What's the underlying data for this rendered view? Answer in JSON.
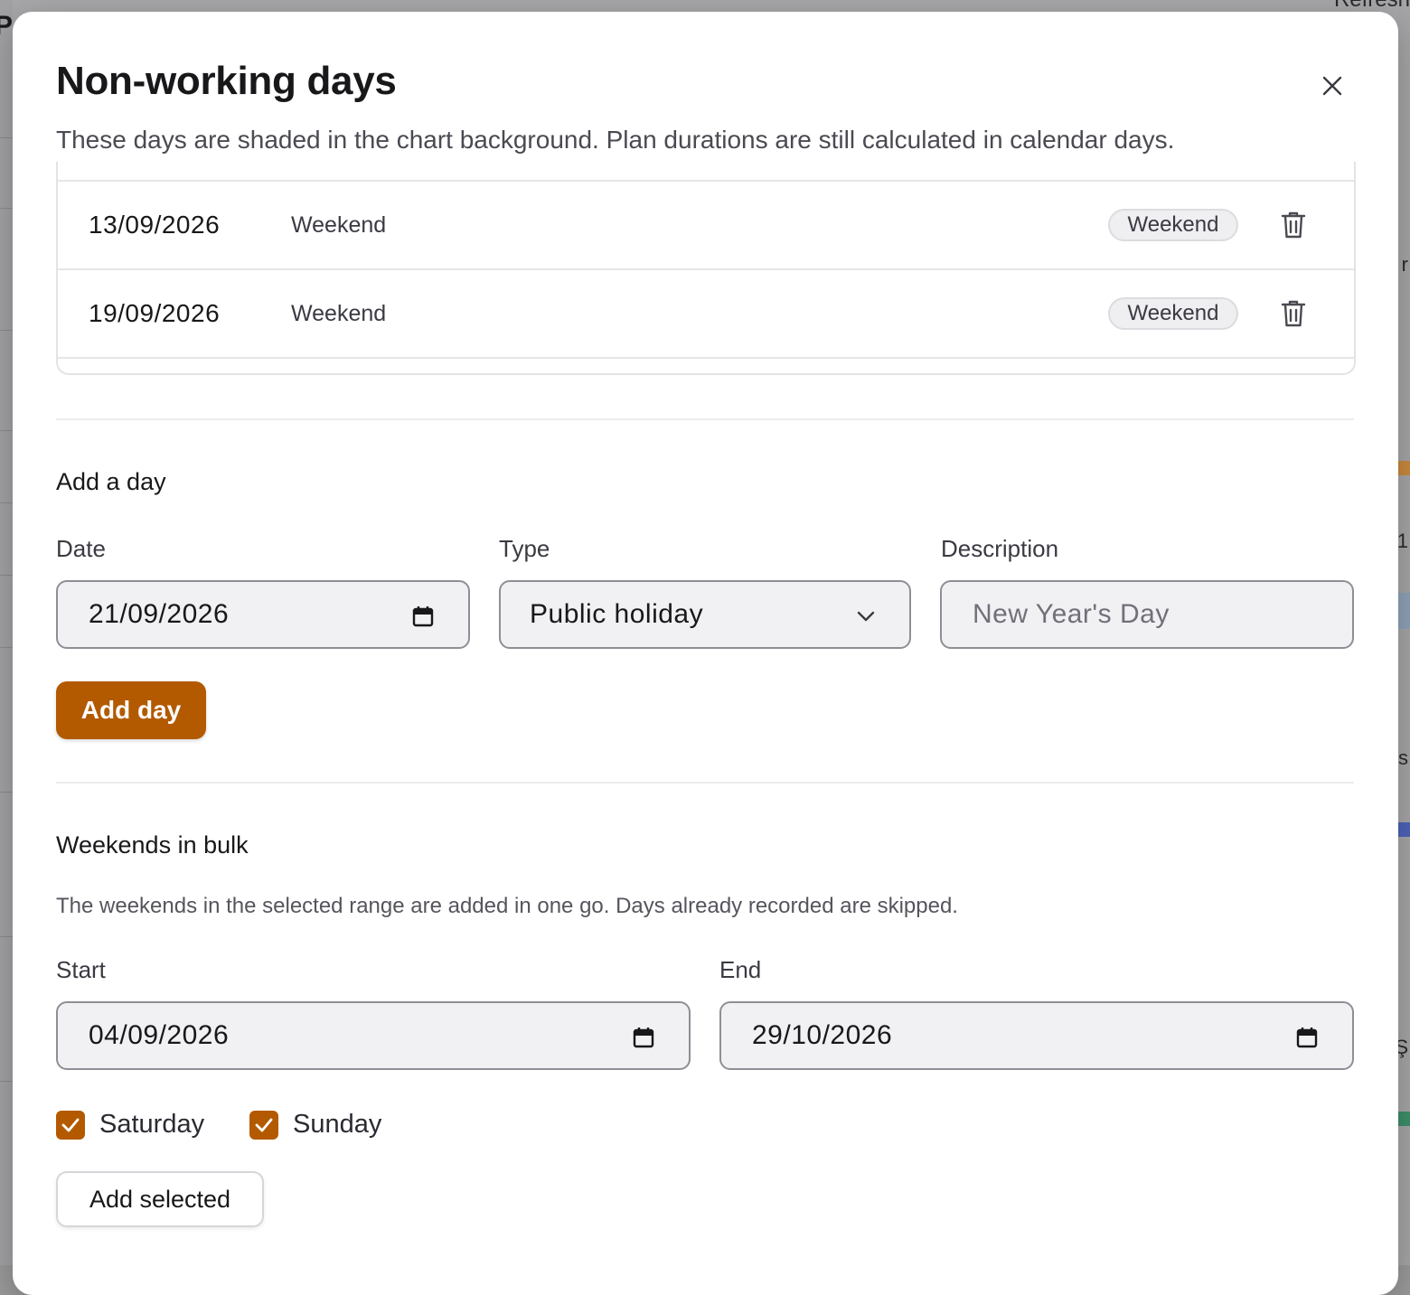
{
  "background": {
    "refresh_label": "Refresh",
    "left_letter": "P",
    "right_fragments": [
      "r",
      "1",
      "s",
      "Ş"
    ]
  },
  "modal": {
    "title": "Non-working days",
    "close_icon": "close-icon",
    "subtitle": "These days are shaded in the chart background. Plan durations are still calculated in calendar days."
  },
  "days_list": [
    {
      "date": "13/09/2026",
      "description": "Weekend",
      "type_badge": "Weekend"
    },
    {
      "date": "19/09/2026",
      "description": "Weekend",
      "type_badge": "Weekend"
    }
  ],
  "add_day": {
    "heading": "Add a day",
    "date_label": "Date",
    "date_value": "21/09/2026",
    "type_label": "Type",
    "type_value": "Public holiday",
    "description_label": "Description",
    "description_placeholder": "New Year's Day",
    "submit_label": "Add day"
  },
  "bulk": {
    "heading": "Weekends in bulk",
    "helper": "The weekends in the selected range are added in one go. Days already recorded are skipped.",
    "start_label": "Start",
    "start_value": "04/09/2026",
    "end_label": "End",
    "end_value": "29/10/2026",
    "saturday_label": "Saturday",
    "saturday_checked": true,
    "sunday_label": "Sunday",
    "sunday_checked": true,
    "submit_label": "Add selected"
  },
  "colors": {
    "accent": "#b35a00",
    "badge_bg": "#efeff1",
    "input_bg": "#f1f1f3"
  }
}
